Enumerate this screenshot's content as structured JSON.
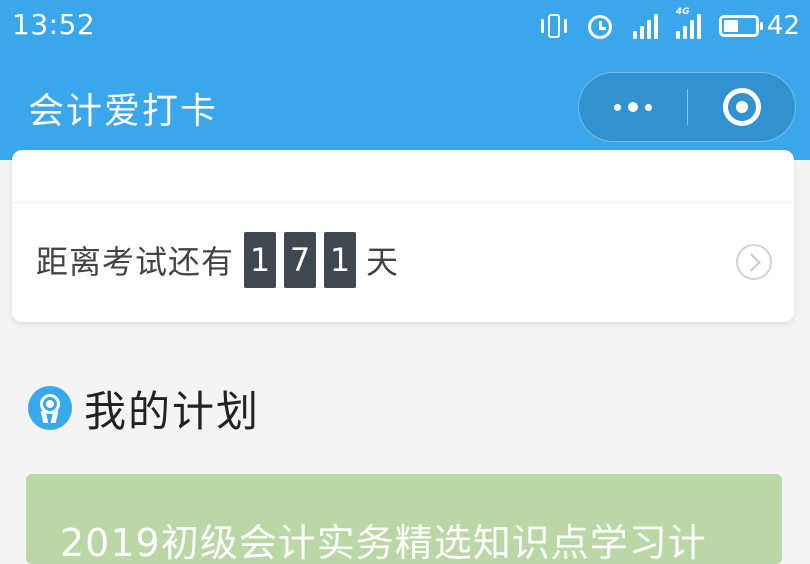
{
  "status_bar": {
    "time": "13:52",
    "network_label": "4G",
    "battery": "42"
  },
  "nav": {
    "title": "会计爱打卡"
  },
  "countdown": {
    "prefix": "距离考试还有",
    "digits": [
      "1",
      "7",
      "1"
    ],
    "suffix": "天"
  },
  "section": {
    "title": "我的计划"
  },
  "plan_card": {
    "text": "2019初级会计实务精选知识点学习计"
  },
  "colors": {
    "header_blue": "#3aa6ec",
    "digit_bg": "#3f4750",
    "plan_card_green": "#b9d8a6",
    "medal_blue": "#39a9ee"
  }
}
